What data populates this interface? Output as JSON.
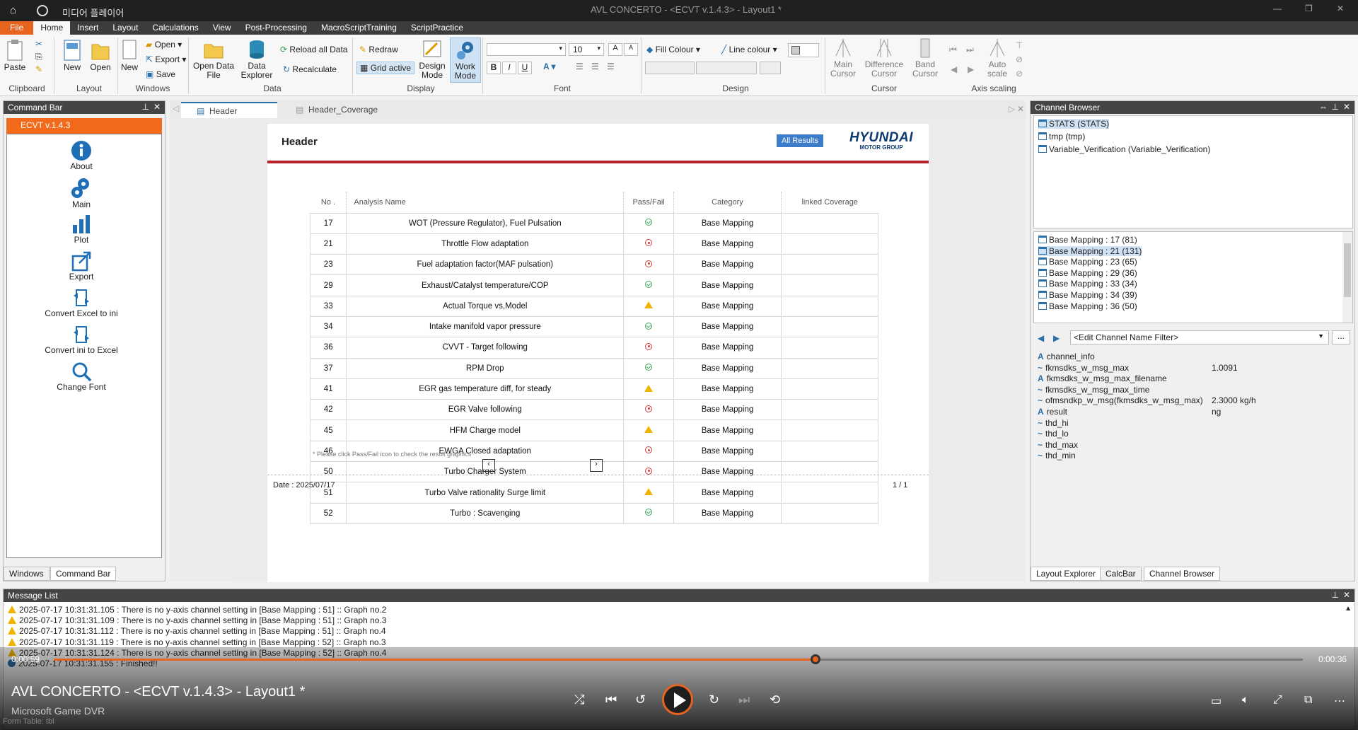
{
  "titlebar": {
    "app_name": "미디어 플레이어",
    "window_title": "AVL CONCERTO - <ECVT v.1.4.3> - Layout1 *"
  },
  "menu": [
    "File",
    "Home",
    "Insert",
    "Layout",
    "Calculations",
    "View",
    "Post-Processing",
    "MacroScriptTraining",
    "ScriptPractice"
  ],
  "ribbon": {
    "paste": "Paste",
    "clipboard": "Clipboard",
    "new_layout": "New",
    "open_layout": "Open",
    "layout": "Layout",
    "new_window": "New",
    "open": "Open",
    "export": "Export",
    "save": "Save",
    "windows": "Windows",
    "open_data_file": "Open Data File",
    "data_explorer": "Data Explorer",
    "reload_all": "Reload all Data",
    "recalculate": "Recalculate",
    "data": "Data",
    "redraw": "Redraw",
    "grid_active": "Grid active",
    "design_mode": "Design Mode",
    "work_mode": "Work Mode",
    "display": "Display",
    "font_size": "10",
    "bold": "B",
    "italic": "I",
    "underline": "U",
    "grow_font": "A",
    "shrink_font": "A",
    "font": "Font",
    "fill_colour": "Fill Colour",
    "line_colour": "Line colour",
    "design": "Design",
    "main_cursor": "Main Cursor",
    "difference_cursor": "Difference Cursor",
    "band_cursor": "Band Cursor",
    "cursor": "Cursor",
    "auto_scale": "Auto scale",
    "axis_scaling": "Axis scaling"
  },
  "command_bar": {
    "title": "Command Bar",
    "header": "ECVT v.1.4.3",
    "items": [
      "About",
      "Main",
      "Plot",
      "Export",
      "Convert Excel to ini",
      "Convert ini to Excel",
      "Change Font"
    ],
    "tabs": [
      "Windows",
      "Command Bar"
    ]
  },
  "doc_tabs": [
    "Header",
    "Header_Coverage"
  ],
  "report": {
    "title": "Header",
    "all_results": "All Results",
    "logo_main": "HYUNDAI",
    "logo_sub": "MOTOR GROUP",
    "columns": [
      "No .",
      "Analysis Name",
      "Pass/Fail",
      "Category",
      "linked Coverage"
    ],
    "rows": [
      {
        "no": "17",
        "name": "WOT (Pressure Regulator), Fuel Pulsation",
        "status": "pass",
        "category": "Base Mapping"
      },
      {
        "no": "21",
        "name": "Throttle Flow adaptation",
        "status": "fail",
        "category": "Base Mapping"
      },
      {
        "no": "23",
        "name": "Fuel adaptation factor(MAF pulsation)",
        "status": "fail",
        "category": "Base Mapping"
      },
      {
        "no": "29",
        "name": "Exhaust/Catalyst temperature/COP",
        "status": "pass",
        "category": "Base Mapping"
      },
      {
        "no": "33",
        "name": "Actual Torque vs,Model",
        "status": "warn",
        "category": "Base Mapping"
      },
      {
        "no": "34",
        "name": "Intake manifold vapor pressure",
        "status": "pass",
        "category": "Base Mapping"
      },
      {
        "no": "36",
        "name": "CVVT - Target following",
        "status": "fail",
        "category": "Base Mapping"
      },
      {
        "no": "37",
        "name": "RPM Drop",
        "status": "pass",
        "category": "Base Mapping"
      },
      {
        "no": "41",
        "name": "EGR gas temperature diff, for steady",
        "status": "warn",
        "category": "Base Mapping"
      },
      {
        "no": "42",
        "name": "EGR Valve following",
        "status": "fail",
        "category": "Base Mapping"
      },
      {
        "no": "45",
        "name": "HFM Charge model",
        "status": "warn",
        "category": "Base Mapping"
      },
      {
        "no": "46",
        "name": "EWGA Closed adaptation",
        "status": "fail",
        "category": "Base Mapping"
      },
      {
        "no": "50",
        "name": "Turbo Charger System",
        "status": "fail",
        "category": "Base Mapping"
      },
      {
        "no": "51",
        "name": "Turbo Valve rationality Surge limit",
        "status": "warn",
        "category": "Base Mapping"
      },
      {
        "no": "52",
        "name": "Turbo : Scavenging",
        "status": "pass",
        "category": "Base Mapping"
      }
    ],
    "note": "* Please click Pass/Fail icon to check the result graphics",
    "date": "Date : 2025/07/17",
    "page": "1 / 1"
  },
  "channel_browser": {
    "title": "Channel Browser",
    "datasets": [
      "STATS (STATS)",
      "tmp (tmp)",
      "Variable_Verification (Variable_Verification)"
    ],
    "groups": [
      "Base Mapping : 17 (81)",
      "Base Mapping : 21 (131)",
      "Base Mapping : 23 (65)",
      "Base Mapping : 29 (36)",
      "Base Mapping : 33 (34)",
      "Base Mapping : 34 (39)",
      "Base Mapping : 36 (50)"
    ],
    "filter_placeholder": "<Edit Channel Name Filter>",
    "channels": [
      {
        "name": "channel_info",
        "type": "A",
        "value": ""
      },
      {
        "name": "fkmsdks_w_msg_max",
        "type": "~",
        "value": "1.0091"
      },
      {
        "name": "fkmsdks_w_msg_max_filename",
        "type": "A",
        "value": ""
      },
      {
        "name": "fkmsdks_w_msg_max_time",
        "type": "~",
        "value": ""
      },
      {
        "name": "ofmsndkp_w_msg(fkmsdks_w_msg_max)",
        "type": "~",
        "value": "2.3000  kg/h"
      },
      {
        "name": "result",
        "type": "A",
        "value": "ng"
      },
      {
        "name": "thd_hi",
        "type": "~",
        "value": ""
      },
      {
        "name": "thd_lo",
        "type": "~",
        "value": ""
      },
      {
        "name": "thd_max",
        "type": "~",
        "value": ""
      },
      {
        "name": "thd_min",
        "type": "~",
        "value": ""
      }
    ],
    "tabs": [
      "Layout Explorer",
      "CalcBar",
      "Channel Browser"
    ]
  },
  "message_list": {
    "title": "Message List",
    "lines": [
      {
        "kind": "warn",
        "text": "2025-07-17 10:31:31.105 : There is no y-axis channel setting in [Base Mapping : 51] :: Graph no.2"
      },
      {
        "kind": "warn",
        "text": "2025-07-17 10:31:31.109 : There is no y-axis channel setting in [Base Mapping : 51] :: Graph no.3"
      },
      {
        "kind": "warn",
        "text": "2025-07-17 10:31:31.112 : There is no y-axis channel setting in [Base Mapping : 51] :: Graph no.4"
      },
      {
        "kind": "warn",
        "text": "2025-07-17 10:31:31.119 : There is no y-axis channel setting in [Base Mapping : 52] :: Graph no.3"
      },
      {
        "kind": "warn",
        "text": "2025-07-17 10:31:31.124 : There is no y-axis channel setting in [Base Mapping : 52] :: Graph no.4"
      },
      {
        "kind": "info",
        "text": "2025-07-17 10:31:31.155 : Finished!!"
      }
    ]
  },
  "player": {
    "elapsed": "0:00:59",
    "remaining": "0:00:36",
    "progress_fraction": 0.61,
    "title": "AVL CONCERTO - <ECVT v.1.4.3> - Layout1 *",
    "subtitle": "Microsoft Game DVR",
    "behind_text": "Form Table: tbl"
  }
}
